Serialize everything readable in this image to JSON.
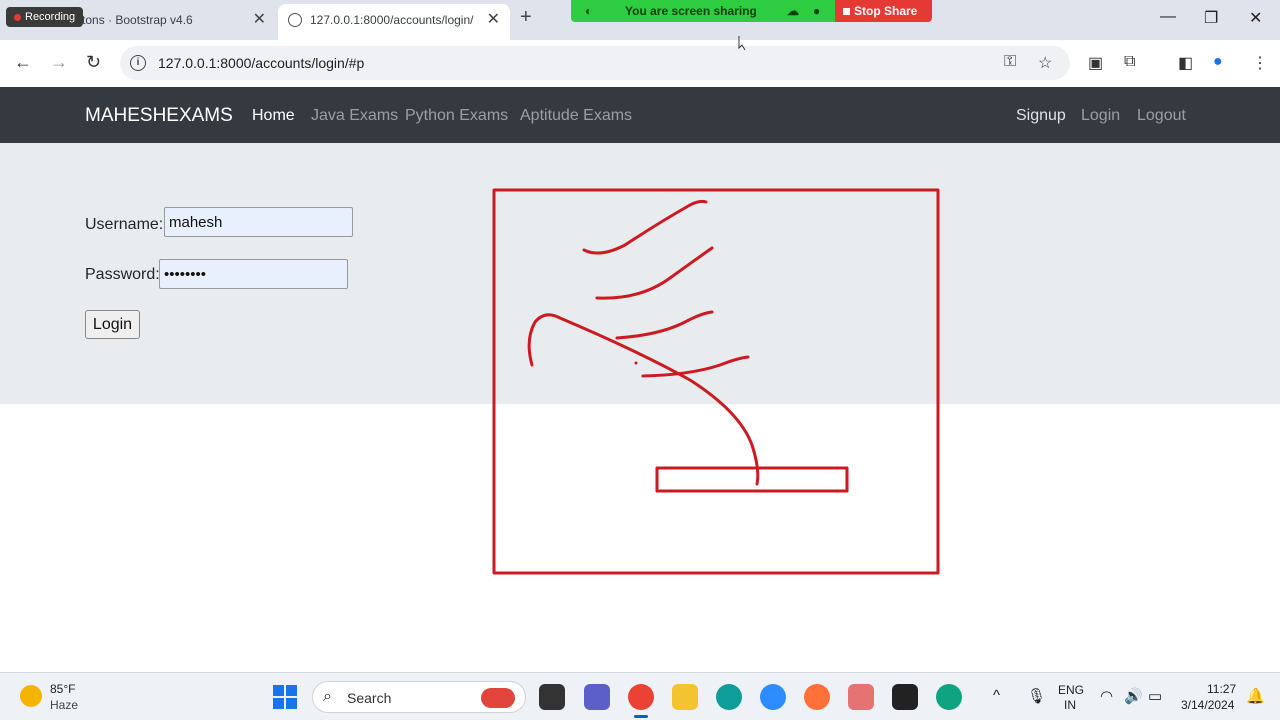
{
  "recording": {
    "label": "Recording"
  },
  "tabs": [
    {
      "label": "uttons · Bootstrap v4.6",
      "close": "✕"
    },
    {
      "label": "127.0.0.1:8000/accounts/login/",
      "close": "✕"
    }
  ],
  "new_tab": "+",
  "share": {
    "message": "You are screen sharing",
    "stop_label": "Stop Share"
  },
  "window": {
    "minimize": "—",
    "restore": "❐",
    "close": "✕"
  },
  "toolbar": {
    "back": "←",
    "forward": "→",
    "reload": "↻",
    "url": "127.0.0.1:8000/accounts/login/#p"
  },
  "navbar": {
    "brand": "MAHESHEXAMS",
    "links": [
      "Home",
      "Java Exams",
      "Python Exams",
      "Aptitude Exams"
    ],
    "right_links": [
      "Signup",
      "Login",
      "Logout"
    ]
  },
  "login_form": {
    "username_label": "Username:",
    "username_value": "mahesh",
    "password_label": "Password:",
    "password_value": "••••••••",
    "submit_label": "Login"
  },
  "taskbar": {
    "temperature": "85°F",
    "weather": "Haze",
    "search_label": "Search",
    "language": "ENG",
    "region": "IN",
    "time": "11:27",
    "date": "3/14/2024"
  },
  "colors": {
    "navbar_bg": "#343a40",
    "jumbotron_bg": "#e9ecef",
    "annotation_red": "#cc1a22",
    "share_green": "#2ecc40",
    "stop_red": "#e53935"
  }
}
